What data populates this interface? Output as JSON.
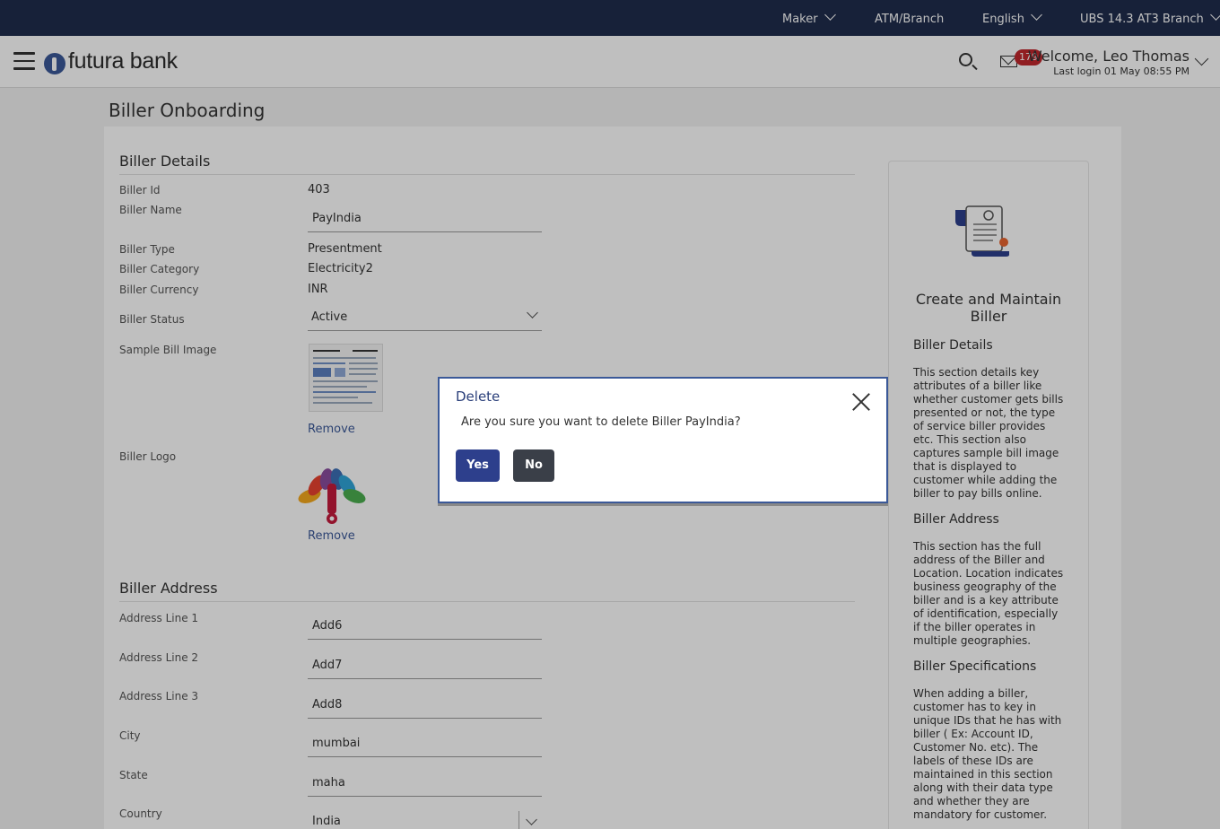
{
  "topbar": {
    "role": "Maker",
    "atm_branch": "ATM/Branch",
    "language": "English",
    "branch": "UBS 14.3 AT3 Branch"
  },
  "header": {
    "logo_text": "futura bank",
    "mail_count": "179",
    "welcome": "Welcome, Leo Thomas",
    "last_login": "Last login 01 May 08:55 PM"
  },
  "page": {
    "title": "Biller Onboarding"
  },
  "biller_details": {
    "section_title": "Biller Details",
    "biller_id_label": "Biller Id",
    "biller_id": "403",
    "biller_name_label": "Biller Name",
    "biller_name": "PayIndia",
    "biller_type_label": "Biller Type",
    "biller_type": "Presentment",
    "biller_category_label": "Biller Category",
    "biller_category": "Electricity2",
    "biller_currency_label": "Biller Currency",
    "biller_currency": "INR",
    "biller_status_label": "Biller Status",
    "biller_status": "Active",
    "sample_bill_label": "Sample Bill Image",
    "remove_label": "Remove",
    "biller_logo_label": "Biller Logo"
  },
  "biller_address": {
    "section_title": "Biller Address",
    "address1_label": "Address Line 1",
    "address1": "Add6",
    "address2_label": "Address Line 2",
    "address2": "Add7",
    "address3_label": "Address Line 3",
    "address3": "Add8",
    "city_label": "City",
    "city": "mumbai",
    "state_label": "State",
    "state": "maha",
    "country_label": "Country",
    "country": "India"
  },
  "side_panel": {
    "title": "Create and Maintain Biller",
    "details_heading": "Biller Details",
    "details_text": "This section details key attributes of a biller like whether customer gets bills presented or not, the type of service biller provides etc. This section also captures sample bill image that is displayed to customer while adding the biller to pay bills online.",
    "address_heading": "Biller Address",
    "address_text": "This section has the full address of the Biller and Location. Location indicates business geography of the biller and is a key attribute of identification, especially if the biller operates in multiple geographies.",
    "spec_heading": "Biller Specifications",
    "spec_text": "When adding a biller, customer has to key in unique IDs that he has with biller ( Ex: Account ID, Customer No. etc). The labels of these IDs are maintained in this section along with their data type and whether they are mandatory for customer."
  },
  "modal": {
    "title": "Delete",
    "message": "Are you sure you want to delete Biller PayIndia?",
    "yes_label": "Yes",
    "no_label": "No"
  }
}
